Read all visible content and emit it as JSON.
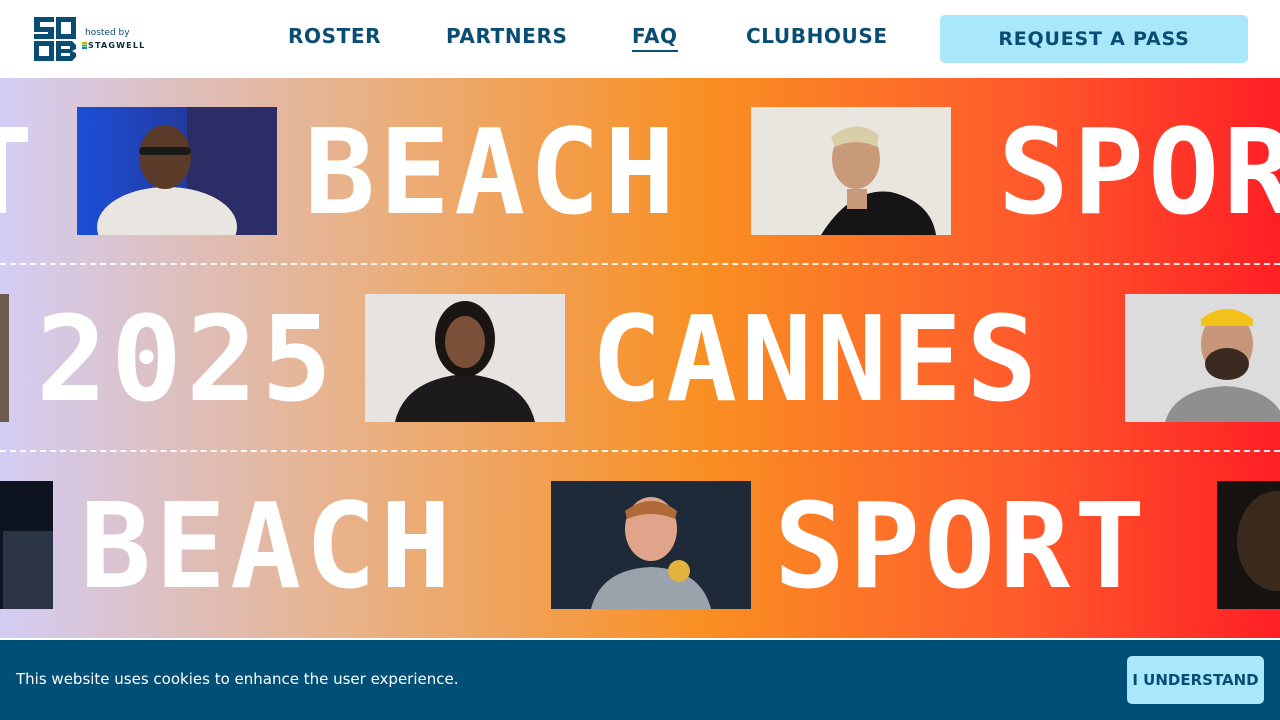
{
  "header": {
    "logo": {
      "monogram": "SB",
      "hosted_label": "hosted by",
      "brand": "STAGWELL"
    },
    "nav": [
      {
        "label": "ROSTER",
        "active": false
      },
      {
        "label": "PARTNERS",
        "active": false
      },
      {
        "label": "FAQ",
        "active": true
      },
      {
        "label": "CLUBHOUSE",
        "active": false
      }
    ],
    "cta_label": "REQUEST A PASS"
  },
  "hero": {
    "rows": [
      {
        "words": [
          "T",
          "BEACH",
          "SPOR"
        ]
      },
      {
        "words": [
          "2025",
          "CANNES"
        ]
      },
      {
        "words": [
          "BEACH",
          "SPORT"
        ]
      }
    ],
    "photos": [
      "portrait-bald-man-glasses",
      "portrait-young-man-black-jacket",
      "portrait-woman-black-blazer",
      "portrait-bearded-man-yellow-cap",
      "portrait-athlete-gold-medal"
    ]
  },
  "cookie_banner": {
    "message": "This website uses cookies to enhance the user experience.",
    "button_label": "I UNDERSTAND"
  },
  "colors": {
    "navy": "#0a4d74",
    "cta_bg": "#a8e8fa",
    "cookie_bg": "#004f77",
    "gradient": [
      "#d3cdf5",
      "#eaaf7e",
      "#f98f22",
      "#ff5a2b",
      "#ff1f25"
    ]
  }
}
